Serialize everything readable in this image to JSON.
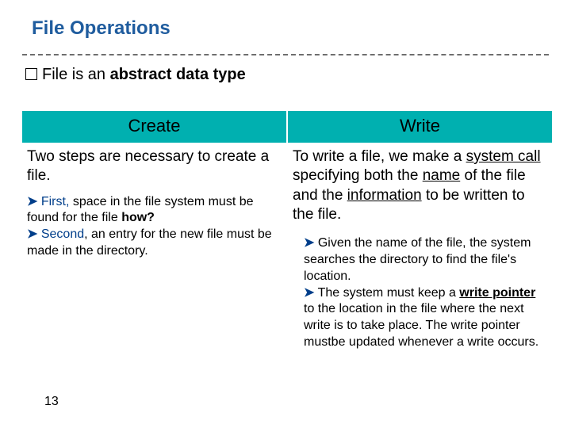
{
  "title": "File Operations",
  "intro": {
    "file": "File",
    "isan": " is an ",
    "adt": "abstract data type"
  },
  "headers": {
    "left": "Create",
    "right": "Write"
  },
  "left": {
    "para": "Two steps are necessary to create a file.",
    "b1_arrow": "➤",
    "b1_first": " First,",
    "b1_rest": " space in the file system must be found for the file ",
    "b1_how": "how?",
    "b2_arrow": "➤",
    "b2_second": " Second",
    "b2_rest": ", an entry for the new file must be made in the directory."
  },
  "right": {
    "p_lead": " To write a file, we make a ",
    "p_syscall": "system call ",
    "p_mid": "specifying both the ",
    "p_name": "name",
    "p_mid2": " of the file and the ",
    "p_info": "information",
    "p_tail": " to be written to the file.",
    "s1_arrow": "➤",
    "s1": " Given the name of the file, the system searches the directory to find the file's location.",
    "s2_arrow": "➤",
    "s2a": " The system must keep a ",
    "s2_wp": "write pointer ",
    "s2b": "to the location in the file where the next write is to take place. The write pointer mustbe updated whenever a write occurs."
  },
  "page": "13"
}
